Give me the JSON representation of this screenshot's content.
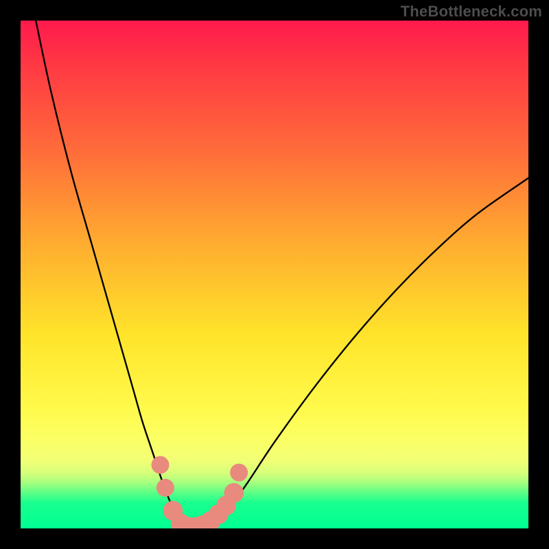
{
  "attribution": "TheBottleneck.com",
  "colors": {
    "frame": "#000000",
    "curve": "#000000",
    "marker": "#e98a7e",
    "gradient_top": "#ff1a4d",
    "gradient_bottom": "#00ff92"
  },
  "chart_data": {
    "type": "line",
    "title": "",
    "xlabel": "",
    "ylabel": "",
    "xlim": [
      0,
      100
    ],
    "ylim": [
      0,
      100
    ],
    "series": [
      {
        "name": "bottleneck-curve",
        "x": [
          3,
          6,
          10,
          14,
          18,
          22,
          24,
          26,
          28,
          30,
          32,
          34,
          36,
          38,
          40,
          44,
          50,
          58,
          66,
          74,
          82,
          90,
          100
        ],
        "y": [
          100,
          86,
          70,
          56,
          42,
          28,
          21,
          15,
          9,
          4,
          1,
          0,
          0,
          1,
          3,
          8,
          17,
          28,
          38,
          47,
          55,
          62,
          69
        ]
      }
    ],
    "markers": [
      {
        "x": 27.5,
        "y": 12.5,
        "r": 1.2
      },
      {
        "x": 28.5,
        "y": 8.0,
        "r": 1.2
      },
      {
        "x": 30.0,
        "y": 3.5,
        "r": 1.4
      },
      {
        "x": 31.5,
        "y": 1.0,
        "r": 1.4
      },
      {
        "x": 33.0,
        "y": 0.3,
        "r": 1.4
      },
      {
        "x": 34.5,
        "y": 0.3,
        "r": 1.4
      },
      {
        "x": 36.0,
        "y": 0.7,
        "r": 1.4
      },
      {
        "x": 37.5,
        "y": 1.5,
        "r": 1.4
      },
      {
        "x": 39.0,
        "y": 2.8,
        "r": 1.4
      },
      {
        "x": 40.5,
        "y": 4.5,
        "r": 1.4
      },
      {
        "x": 42.0,
        "y": 7.0,
        "r": 1.4
      },
      {
        "x": 43.0,
        "y": 11.0,
        "r": 1.2
      }
    ]
  }
}
